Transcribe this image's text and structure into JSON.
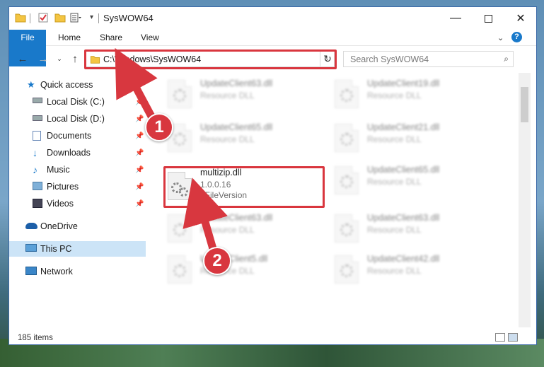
{
  "window": {
    "title": "SysWOW64",
    "minimize_icon": "minimize-icon",
    "maximize_icon": "maximize-icon",
    "close_icon": "close-icon"
  },
  "ribbon": {
    "tabs": [
      {
        "label": "File"
      },
      {
        "label": "Home"
      },
      {
        "label": "Share"
      },
      {
        "label": "View"
      }
    ]
  },
  "address": {
    "path": "C:\\Windows\\SysWOW64",
    "search_placeholder": "Search SysWOW64"
  },
  "sidebar": {
    "items": [
      {
        "label": "Quick access",
        "icon": "star-icon"
      },
      {
        "label": "Local Disk (C:)",
        "icon": "drive-icon"
      },
      {
        "label": "Local Disk (D:)",
        "icon": "drive-icon"
      },
      {
        "label": "Documents",
        "icon": "documents-icon"
      },
      {
        "label": "Downloads",
        "icon": "download-icon"
      },
      {
        "label": "Music",
        "icon": "music-icon"
      },
      {
        "label": "Pictures",
        "icon": "pictures-icon"
      },
      {
        "label": "Videos",
        "icon": "videos-icon"
      },
      {
        "label": "OneDrive",
        "icon": "cloud-icon"
      },
      {
        "label": "This PC",
        "icon": "computer-icon"
      },
      {
        "label": "Network",
        "icon": "network-icon"
      }
    ]
  },
  "files": {
    "left": [
      {
        "name": "UpdateClient63.dll",
        "type": "Resource DLL"
      },
      {
        "name": "UpdateClient65.dll",
        "type": "Resource DLL"
      },
      {
        "name": "multizip.dll",
        "version": "1.0.0.16",
        "type": "8FileVersion"
      },
      {
        "name": "UpdateClient63.dll",
        "type": "Resource DLL"
      },
      {
        "name": "UpdateClient5.dll",
        "type": "Resource DLL"
      }
    ],
    "right": [
      {
        "name": "UpdateClient19.dll",
        "type": "Resource DLL"
      },
      {
        "name": "UpdateClient21.dll",
        "type": "Resource DLL"
      },
      {
        "name": "UpdateClient65.dll",
        "type": "Resource DLL"
      },
      {
        "name": "UpdateClient63.dll",
        "type": "Resource DLL"
      },
      {
        "name": "UpdateClient42.dll",
        "type": "Resource DLL"
      }
    ]
  },
  "status": {
    "count": "185 items"
  },
  "callouts": [
    "1",
    "2"
  ],
  "colors": {
    "accent": "#1979ca",
    "highlight": "#d9363e",
    "selected": "#cce4f7"
  }
}
